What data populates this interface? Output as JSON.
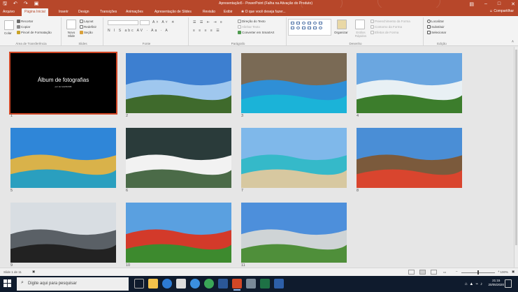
{
  "window": {
    "title": "Apresentação5 - PowerPoint (Falha na Ativação do Produto)",
    "quick_access": [
      "save-icon",
      "undo-icon",
      "redo-icon",
      "start-from-beginning-icon"
    ],
    "controls": [
      "restore-ribbon-icon",
      "minimize-icon",
      "maximize-icon",
      "close-icon"
    ]
  },
  "tabs": [
    {
      "label": "Arquivo"
    },
    {
      "label": "Página Inicial",
      "active": true
    },
    {
      "label": "Inserir"
    },
    {
      "label": "Design"
    },
    {
      "label": "Transições"
    },
    {
      "label": "Animações"
    },
    {
      "label": "Apresentação de Slides"
    },
    {
      "label": "Revisão"
    },
    {
      "label": "Exibir"
    },
    {
      "label": "O que você deseja fazer..."
    }
  ],
  "share_label": "Compartilhar",
  "ribbon": {
    "clipboard": {
      "group": "Área de Transferência",
      "paste": "Colar",
      "cut": "Recortar",
      "copy": "Copiar",
      "format_painter": "Pincel de Formatação"
    },
    "slides": {
      "group": "Slides",
      "new_slide": "Novo Slide",
      "layout": "Layout",
      "reset": "Redefinir",
      "section": "Seção"
    },
    "font": {
      "group": "Fonte",
      "font_name": "",
      "font_size": "",
      "styles": "N I S abc AV · Aa · A"
    },
    "paragraph": {
      "group": "Parágrafo",
      "text_direction": "Direção do Texto",
      "align_text": "Alinhar Texto",
      "smartart": "Converter em SmartArt"
    },
    "drawing": {
      "group": "Desenho",
      "arrange": "Organizar",
      "quick_styles": "Estilos Rápidos",
      "shape_fill": "Preenchimento da Forma",
      "shape_outline": "Contorno da Forma",
      "shape_effects": "Efeitos de Forma"
    },
    "editing": {
      "group": "Edição",
      "find": "Localizar",
      "replace": "Substituir",
      "select": "Selecionar"
    }
  },
  "slides": [
    {
      "number": "1",
      "title": "Álbum de fotografias",
      "subtitle": "por tec.teleSGSM",
      "selected": true
    },
    {
      "number": "2",
      "scene": "christ-redeemer-rio",
      "colors": [
        "#3d7fd0",
        "#9fc7ee",
        "#3f6a2c"
      ]
    },
    {
      "number": "3",
      "scene": "blue-grotto-cave",
      "colors": [
        "#7a6a55",
        "#2f8fd6",
        "#1bb3d8"
      ]
    },
    {
      "number": "4",
      "scene": "iguazu-falls",
      "colors": [
        "#6aa6e0",
        "#e8f0f4",
        "#3c7d2c"
      ]
    },
    {
      "number": "5",
      "scene": "salvador-elevator",
      "colors": [
        "#2f86d8",
        "#d9b24a",
        "#2a9fbf"
      ]
    },
    {
      "number": "6",
      "scene": "waterfalls-gorge",
      "colors": [
        "#2a3b3a",
        "#f2f2f2",
        "#4b6b48"
      ]
    },
    {
      "number": "7",
      "scene": "tropical-beach",
      "colors": [
        "#7fb8ea",
        "#35b9c9",
        "#d7c8a0"
      ]
    },
    {
      "number": "8",
      "scene": "gramado-cathedral",
      "colors": [
        "#4a8ed6",
        "#7b5a3c",
        "#d9452e"
      ]
    },
    {
      "number": "9",
      "scene": "brasilia-cathedral",
      "colors": [
        "#d8dde2",
        "#5a6066",
        "#222222"
      ]
    },
    {
      "number": "10",
      "scene": "botanical-garden",
      "colors": [
        "#5aa0e0",
        "#d33a2a",
        "#3d8a2e"
      ]
    },
    {
      "number": "11",
      "scene": "national-congress",
      "colors": [
        "#4d8fdb",
        "#cfd4d6",
        "#4f8f3a"
      ]
    }
  ],
  "status": {
    "slide_count": "Slide 1 de 11",
    "zoom": "100%"
  },
  "taskbar": {
    "search_placeholder": "Digite aqui para pesquisar",
    "apps": [
      "task-view-icon",
      "file-explorer-icon",
      "edge-icon",
      "store-icon",
      "ie-icon",
      "chrome-icon",
      "word-icon",
      "powerpoint-icon",
      "excel-icon",
      "mail-icon",
      "terminal-icon"
    ],
    "time": "21:15",
    "date": "20/05/2020"
  }
}
